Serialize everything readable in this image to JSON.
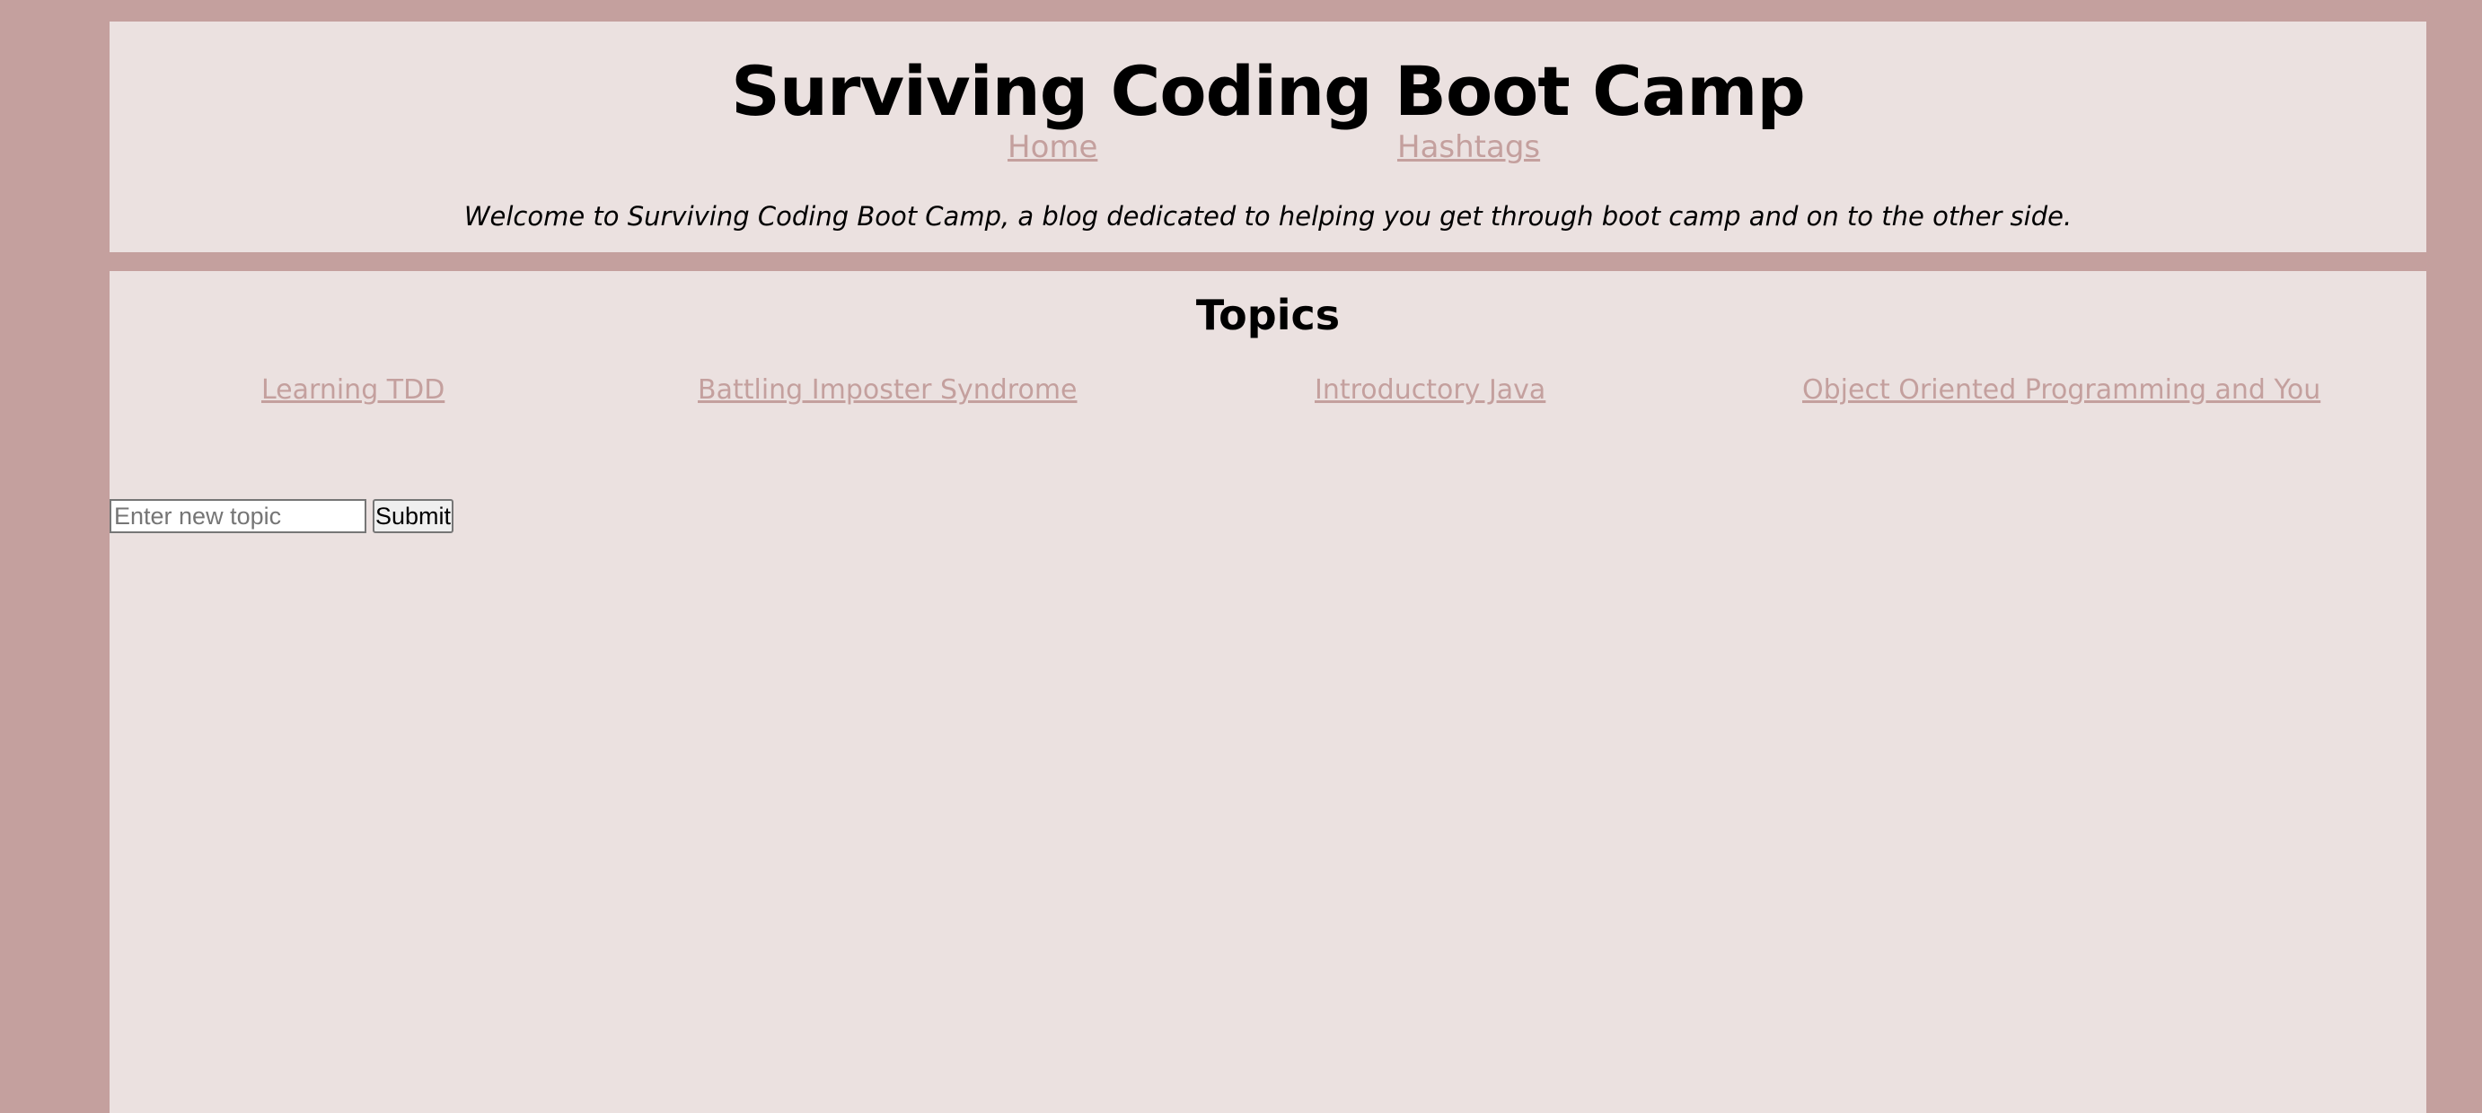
{
  "header": {
    "title": "Surviving Coding Boot Camp",
    "nav": {
      "home": "Home",
      "hashtags": "Hashtags"
    },
    "tagline": "Welcome to Surviving Coding Boot Camp, a blog dedicated to helping you get through boot camp and on to the other side."
  },
  "topics": {
    "heading": "Topics",
    "items": [
      {
        "label": "Learning TDD"
      },
      {
        "label": "Battling Imposter Syndrome"
      },
      {
        "label": "Introductory Java"
      },
      {
        "label": "Object Oriented Programming and You"
      }
    ]
  },
  "new_topic_form": {
    "input_value": "",
    "input_placeholder": "Enter new topic",
    "submit_label": "Submit"
  },
  "colors": {
    "page_background": "#c4a09e",
    "panel_background": "#ebe1e0",
    "link": "#c4a09e",
    "text": "#000000"
  }
}
